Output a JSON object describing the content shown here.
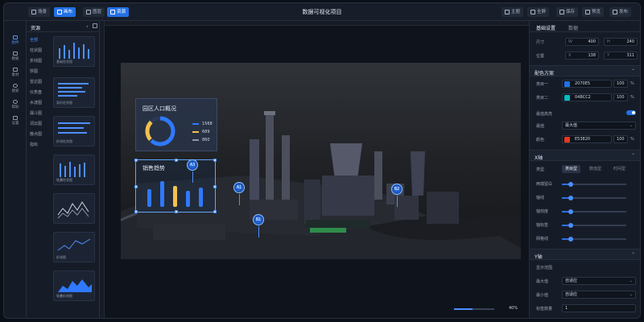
{
  "header": {
    "title": "数据可视化项目",
    "left_buttons": [
      "场景",
      "画布",
      "图层",
      "资源"
    ],
    "right_buttons": [
      "主题",
      "全屏",
      "保存",
      "预览",
      "发布"
    ]
  },
  "rail": {
    "items": [
      "组件",
      "模板",
      "素材",
      "搜索",
      "帮助",
      "设置"
    ]
  },
  "library": {
    "title": "资源",
    "categories": [
      "全部",
      "柱状图",
      "折线图",
      "饼图",
      "雷达图",
      "仪表盘",
      "水波图",
      "漏斗图",
      "词云图",
      "散点图",
      "指标"
    ],
    "thumbnails": [
      "基础柱状图",
      "条形柱状图",
      "折线柱状图",
      "堆叠柱状图",
      "",
      "折线图",
      "堆叠折线图"
    ]
  },
  "stage": {
    "overview_title": "园区人口概况",
    "overview_values": [
      "1568",
      "689",
      "860"
    ],
    "sales_title": "销售趋势",
    "markers": [
      "A1",
      "A3",
      "B1",
      "B2"
    ],
    "zoom": "40%",
    "zoom_level": 0.45
  },
  "props": {
    "tabs": [
      "基础设置",
      "数据"
    ],
    "size_label": "尺寸",
    "width_prefix": "W",
    "width": "400",
    "height_prefix": "H",
    "height": "240",
    "pos_label": "位置",
    "x_prefix": "X",
    "x": "138",
    "y_prefix": "Y",
    "y": "311",
    "color_section": "配色方案",
    "color1_label": "类目一",
    "color1_hex": "2070E5",
    "color1_pct": "100",
    "color2_label": "类目二",
    "color2_hex": "04BCC2",
    "color2_pct": "100",
    "highlight_label": "最值高亮",
    "highlight_on": true,
    "highlight_type_label": "最值",
    "highlight_type": "最大值",
    "highlight_color_label": "颜色",
    "highlight_color_hex": "E53820",
    "highlight_color_pct": "100",
    "pct_unit": "%",
    "xaxis_section": "X轴",
    "xaxis_type_label": "类型",
    "xaxis_types": [
      "类目型",
      "数值型",
      "时间型"
    ],
    "xaxis_rows": [
      "两端留白",
      "轴线",
      "轴刻度",
      "轴标签",
      "网格线"
    ],
    "yaxis_section": "Y轴",
    "yaxis_range_label": "显示范围",
    "ymax_label": "最大值",
    "ymax_value": "自适应",
    "ymin_label": "最小值",
    "ymin_value": "自适应",
    "tick_count_label": "标签数量",
    "tick_count_value": "1"
  },
  "colors": {
    "accent": "#2270e5",
    "color1": "#2070E5",
    "color2": "#04BCC2",
    "highlight": "#E53820",
    "gauge_yellow": "#f2c14e"
  }
}
